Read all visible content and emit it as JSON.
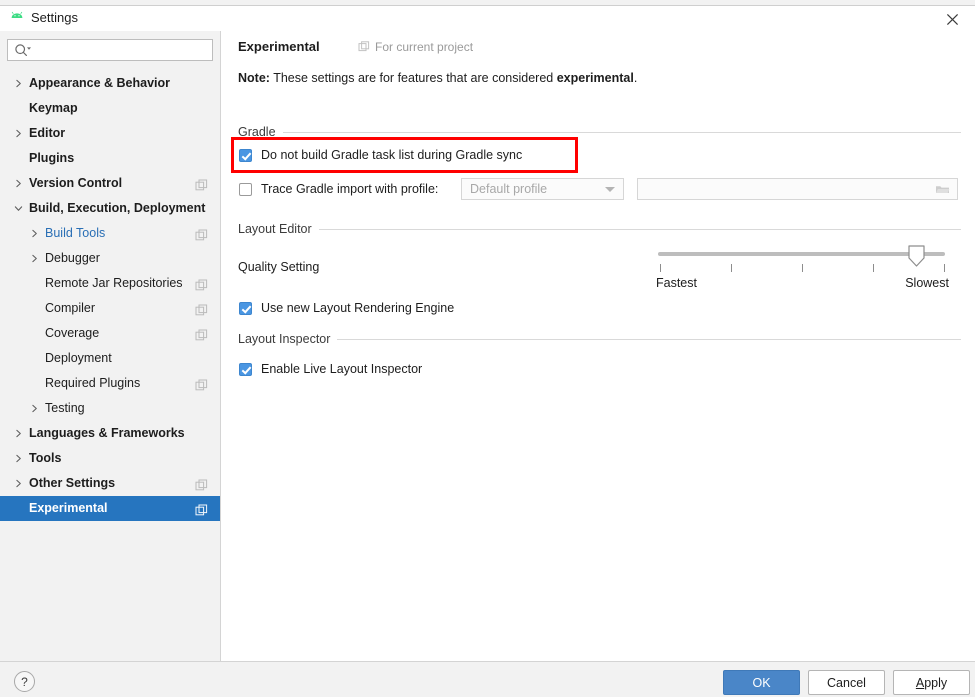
{
  "window": {
    "title": "Settings",
    "app_icon": "android-robot-icon",
    "close_icon": "close-icon",
    "ghost_title_strip": ""
  },
  "sidebar": {
    "search": {
      "placeholder": "",
      "value": "",
      "icon": "search-icon"
    },
    "items": [
      {
        "label": "Appearance & Behavior",
        "depth": 0,
        "twisty": "collapsed",
        "bold": true,
        "scope_icon": false,
        "selected": false,
        "link": false
      },
      {
        "label": "Keymap",
        "depth": 0,
        "twisty": "none",
        "bold": true,
        "scope_icon": false,
        "selected": false,
        "link": false
      },
      {
        "label": "Editor",
        "depth": 0,
        "twisty": "collapsed",
        "bold": true,
        "scope_icon": false,
        "selected": false,
        "link": false
      },
      {
        "label": "Plugins",
        "depth": 0,
        "twisty": "none",
        "bold": true,
        "scope_icon": false,
        "selected": false,
        "link": false
      },
      {
        "label": "Version Control",
        "depth": 0,
        "twisty": "collapsed",
        "bold": true,
        "scope_icon": true,
        "selected": false,
        "link": false
      },
      {
        "label": "Build, Execution, Deployment",
        "depth": 0,
        "twisty": "expanded",
        "bold": true,
        "scope_icon": false,
        "selected": false,
        "link": false
      },
      {
        "label": "Build Tools",
        "depth": 1,
        "twisty": "collapsed",
        "bold": false,
        "scope_icon": true,
        "selected": false,
        "link": true
      },
      {
        "label": "Debugger",
        "depth": 1,
        "twisty": "collapsed",
        "bold": false,
        "scope_icon": false,
        "selected": false,
        "link": false
      },
      {
        "label": "Remote Jar Repositories",
        "depth": 1,
        "twisty": "none",
        "bold": false,
        "scope_icon": true,
        "selected": false,
        "link": false
      },
      {
        "label": "Compiler",
        "depth": 1,
        "twisty": "none",
        "bold": false,
        "scope_icon": true,
        "selected": false,
        "link": false
      },
      {
        "label": "Coverage",
        "depth": 1,
        "twisty": "none",
        "bold": false,
        "scope_icon": true,
        "selected": false,
        "link": false
      },
      {
        "label": "Deployment",
        "depth": 1,
        "twisty": "none",
        "bold": false,
        "scope_icon": false,
        "selected": false,
        "link": false
      },
      {
        "label": "Required Plugins",
        "depth": 1,
        "twisty": "none",
        "bold": false,
        "scope_icon": true,
        "selected": false,
        "link": false
      },
      {
        "label": "Testing",
        "depth": 1,
        "twisty": "collapsed",
        "bold": false,
        "scope_icon": false,
        "selected": false,
        "link": false
      },
      {
        "label": "Languages & Frameworks",
        "depth": 0,
        "twisty": "collapsed",
        "bold": true,
        "scope_icon": false,
        "selected": false,
        "link": false
      },
      {
        "label": "Tools",
        "depth": 0,
        "twisty": "collapsed",
        "bold": true,
        "scope_icon": false,
        "selected": false,
        "link": false
      },
      {
        "label": "Other Settings",
        "depth": 0,
        "twisty": "collapsed",
        "bold": true,
        "scope_icon": true,
        "selected": false,
        "link": false
      },
      {
        "label": "Experimental",
        "depth": 0,
        "twisty": "none",
        "bold": true,
        "scope_icon": true,
        "selected": true,
        "link": false
      }
    ]
  },
  "main": {
    "page_title": "Experimental",
    "scope_badge": "For current project",
    "scope_badge_icon": "project-scope-icon",
    "note_prefix": "Note:",
    "note_body": " These settings are for features that are considered ",
    "note_emphasis": "experimental",
    "note_suffix": ".",
    "sections": {
      "gradle": {
        "title": "Gradle",
        "no_task_list": {
          "label": "Do not build Gradle task list during Gradle sync",
          "checked": true
        },
        "trace_import": {
          "label": "Trace Gradle import with profile:",
          "checked": false
        },
        "profile_select": {
          "value": "Default profile",
          "caret_icon": "chevron-down-icon",
          "disabled": true
        },
        "profile_path": {
          "value": "",
          "placeholder": "",
          "browse_icon": "folder-icon",
          "disabled": true
        }
      },
      "layout_editor": {
        "title": "Layout Editor",
        "quality_label": "Quality Setting",
        "slider": {
          "min_label": "Fastest",
          "max_label": "Slowest",
          "ticks": 5,
          "value": 5,
          "value_index": 4
        },
        "rendering_engine": {
          "label": "Use new Layout Rendering Engine",
          "checked": true
        }
      },
      "layout_inspector": {
        "title": "Layout Inspector",
        "live_inspector": {
          "label": "Enable Live Layout Inspector",
          "checked": true
        }
      }
    }
  },
  "annotation": {
    "color": "#ff0000",
    "target": "do-not-build-gradle-task-list-checkbox"
  },
  "footer": {
    "help_label": "?",
    "ok_label": "OK",
    "cancel_label": "Cancel",
    "apply_label_mnemonic": "A",
    "apply_label_rest": "pply"
  }
}
